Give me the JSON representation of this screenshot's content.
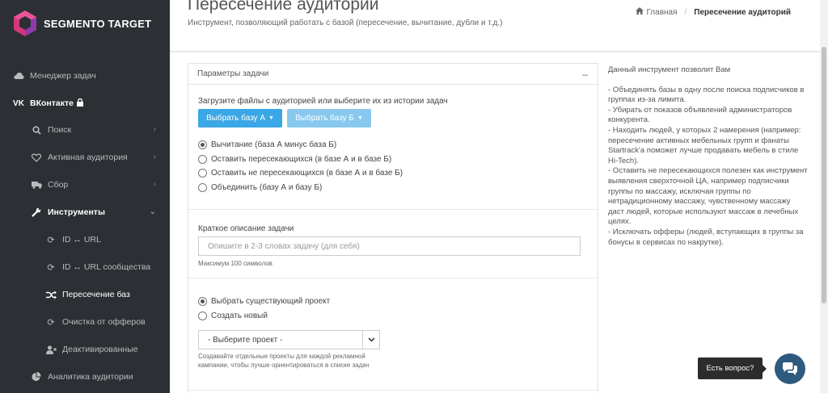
{
  "app": {
    "logo_text": "SEGMENTO TARGET"
  },
  "sidebar": {
    "items": [
      {
        "label": "Менеджер задач",
        "icon": "cloud-icon"
      },
      {
        "label": "ВКонтакте",
        "icon": "vk-icon"
      },
      {
        "label": "Поиск",
        "icon": "search-icon"
      },
      {
        "label": "Активная аудитория",
        "icon": "heart-icon"
      },
      {
        "label": "Сбор",
        "icon": "truck-icon"
      },
      {
        "label": "Инструменты",
        "icon": "wrench-icon"
      },
      {
        "label": "ID ↔ URL",
        "icon": "refresh-icon"
      },
      {
        "label": "ID ↔ URL сообщества",
        "icon": "refresh-icon"
      },
      {
        "label": "Пересечение баз",
        "icon": "shuffle-icon"
      },
      {
        "label": "Очистка от офферов",
        "icon": "refresh-icon"
      },
      {
        "label": "Деактивированные",
        "icon": "user-times-icon"
      },
      {
        "label": "Аналитика аудитории",
        "icon": "pie-chart-icon"
      }
    ]
  },
  "header": {
    "title": "Пересечение аудиторий",
    "subtitle": "Инструмент, позволяющий работать с базой (пересечение, вычитание, дубли и т.д.)",
    "breadcrumb": {
      "home": "Главная",
      "current": "Пересечение аудиторий"
    }
  },
  "panel": {
    "title": "Параметры задачи",
    "collapse": "–",
    "load_label": "Загрузите файлы с аудиторией или выберите их из истории задач",
    "btn_a": "Выбрать базу А",
    "btn_b": "Выбрать базу Б",
    "operations": [
      "Вычитание (база А минус база Б)",
      "Оставить пересекающихся (в базе А и в базе Б)",
      "Оставить не пересекающихся (в базе А и в базе Б)",
      "Объединить (базу А и базу Б)"
    ],
    "desc_label": "Краткое описание задачи",
    "desc_placeholder": "Опишите в 2-3 словах задачу (для себя)",
    "desc_help": "Максимум 100 символов",
    "project_options": [
      "Выбрать существующий проект",
      "Создать новый"
    ],
    "project_select": "- Выберите проект -",
    "project_help": "Создавайте отдельные проекты для каждой рекламной кампании, чтобы лучше ориентироваться в списке задач"
  },
  "info": {
    "intro": "Данный инструмент позволит Вам",
    "body": "- Объединять базы в одну после поиска подписчиков в группах из-за лимита.\n- Убирать от показов объявлений администраторов конкурента.\n- Находить людей, у которых 2 намерения (например: пересечение активных мебельных групп и фанаты Startrack'a поможет лучше продавать мебель в стиле Hi-Tech).\n- Оставить не пересекающихся полезен как инструмент выявления сверхточной ЦА, например подписчики группы по массажу, исключая группы по нетрадиционному массажу, чувственному массажу даст людей, которые используют массаж в лечебных целях.\n- Исключать офферы (людей, вступающих в группы за бонусы в сервисах по накрутке)."
  },
  "chat": {
    "tooltip": "Есть вопрос?"
  },
  "colors": {
    "sidebar_bg": "#2c2f33",
    "primary": "#3aa7e6",
    "primary_light": "#88c8ee",
    "chat": "#2f5a7f"
  }
}
